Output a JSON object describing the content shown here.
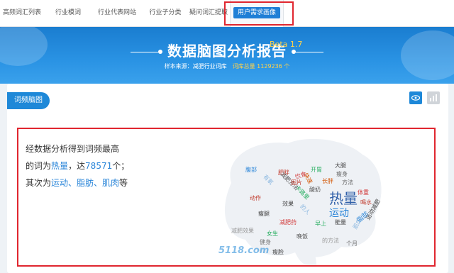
{
  "nav": {
    "tabs": [
      {
        "label": "高频词汇列表",
        "active": false
      },
      {
        "label": "行业模词",
        "active": false
      },
      {
        "label": "行业代表网站",
        "active": false
      },
      {
        "label": "行业子分类",
        "active": false
      },
      {
        "label": "疑问词汇提取",
        "active": false
      },
      {
        "label": "用户需求画像",
        "active": true
      }
    ]
  },
  "banner": {
    "title": "数据脑图分析报告",
    "version": "Beta 1.7",
    "source_label": "样本来源：",
    "source_value": "减肥行业词库",
    "total_label": "词库总量 1129236 个"
  },
  "panel": {
    "tab_label": "词频脑图",
    "desc": {
      "line1": "经数据分析得到词频最高",
      "line2_prefix": "的词为",
      "top_word": "热量",
      "line2_mid": "，达",
      "top_count": "78571",
      "line2_suffix": "个；",
      "line3_prefix": "其次为",
      "others": "运动、脂肪、肌肉",
      "line3_suffix": "等"
    },
    "watermark": "5118.com"
  },
  "colors": {
    "accent": "#1e88d8",
    "highlight_border": "#e0262f",
    "beta": "#ffd24a"
  },
  "wordcloud": [
    {
      "text": "热量",
      "color": "#2f5fa8"
    },
    {
      "text": "运动",
      "color": "#2b86d9"
    },
    {
      "text": "脂肪",
      "color": "#2b86d9"
    },
    {
      "text": "肌肉",
      "color": "#8bb8e0"
    },
    {
      "text": "大腿",
      "color": "#444"
    },
    {
      "text": "瘦身",
      "color": "#666"
    },
    {
      "text": "方法",
      "color": "#666"
    },
    {
      "text": "体重",
      "color": "#d23a3a"
    },
    {
      "text": "喝水",
      "color": "#c0392b"
    },
    {
      "text": "运动减肥",
      "color": "#444"
    },
    {
      "text": "腹部",
      "color": "#2b86d9"
    },
    {
      "text": "肥胖",
      "color": "#c0392b"
    },
    {
      "text": "减肥方法",
      "color": "#555"
    },
    {
      "text": "长胖",
      "color": "#d35400"
    },
    {
      "text": "效果",
      "color": "#444"
    },
    {
      "text": "动作",
      "color": "#c0392b"
    },
    {
      "text": "瘦腿",
      "color": "#444"
    },
    {
      "text": "减肥药",
      "color": "#d23a3a"
    },
    {
      "text": "健身",
      "color": "#777"
    },
    {
      "text": "女生",
      "color": "#27ae60"
    },
    {
      "text": "晚饭",
      "color": "#555"
    },
    {
      "text": "瘦脸",
      "color": "#444"
    },
    {
      "text": "能量",
      "color": "#444"
    },
    {
      "text": "早上",
      "color": "#27ae60"
    },
    {
      "text": "个月",
      "color": "#777"
    },
    {
      "text": "减肥效果",
      "color": "#999"
    },
    {
      "text": "酸奶",
      "color": "#555"
    },
    {
      "text": "卡路里",
      "color": "#27ae60"
    },
    {
      "text": "快速",
      "color": "#d35400"
    },
    {
      "text": "有氧",
      "color": "#8bb8e0"
    },
    {
      "text": "图片",
      "color": "#c0392b"
    },
    {
      "text": "饮食",
      "color": "#d23a3a"
    },
    {
      "text": "开胃",
      "color": "#27ae60"
    },
    {
      "text": "的人",
      "color": "#8bb8e0"
    },
    {
      "text": "的方法",
      "color": "#999"
    }
  ]
}
